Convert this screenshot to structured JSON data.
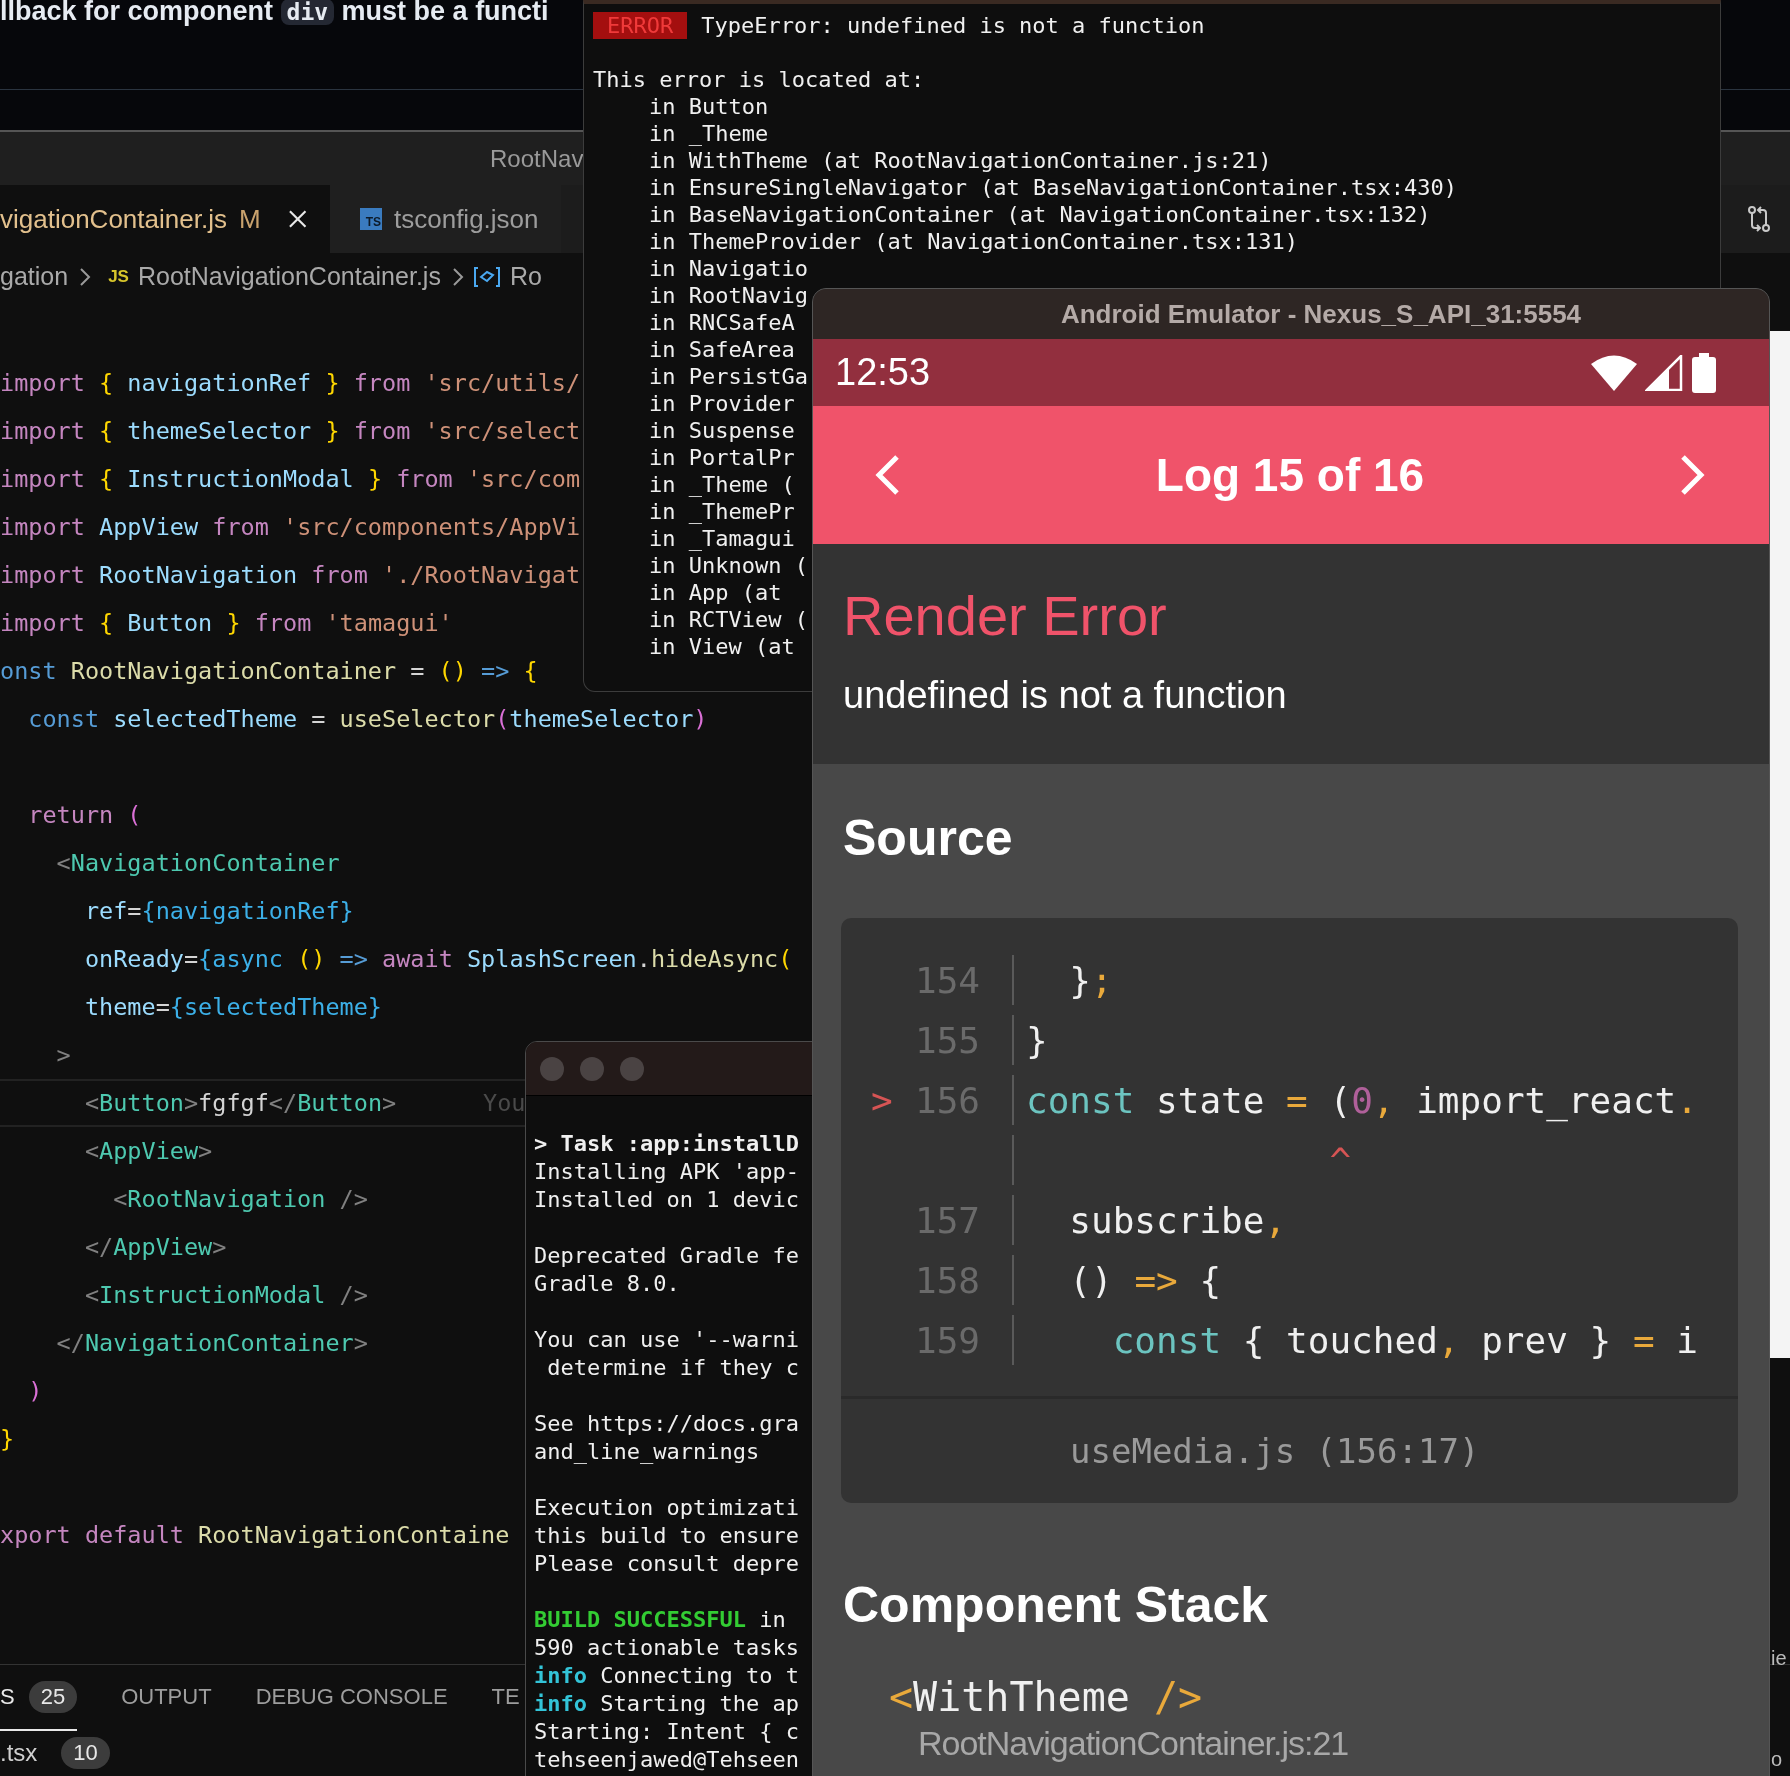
{
  "error_banner": {
    "message_parts": [
      {
        "text": "llback for component ",
        "kind": "plain"
      },
      {
        "text": "div",
        "kind": "code"
      },
      {
        "text": " must be a functi",
        "kind": "plain"
      }
    ]
  },
  "editor": {
    "title": "RootNav",
    "tabs": [
      {
        "label": "vigationContainer.js",
        "status": "M",
        "selected": true,
        "kind": "script"
      },
      {
        "label": "tsconfig.json",
        "selected": false,
        "kind": "config",
        "badge": "TS"
      }
    ],
    "breadcrumb": {
      "folder": "gation",
      "file_badge": "JS",
      "file": "RootNavigationContainer.js",
      "symbol": "Ro"
    },
    "code_lines": [
      {
        "kind": "code",
        "current": false,
        "tokens": [
          {
            "text": "import ",
            "kind": "keyword"
          },
          {
            "text": "{ ",
            "kind": "brace"
          },
          {
            "text": "navigationRef ",
            "kind": "var"
          },
          {
            "text": "} ",
            "kind": "brace"
          },
          {
            "text": "from ",
            "kind": "keyword"
          },
          {
            "text": "'src/utils/",
            "kind": "string"
          }
        ]
      },
      {
        "kind": "code",
        "current": false,
        "tokens": [
          {
            "text": "import ",
            "kind": "keyword"
          },
          {
            "text": "{ ",
            "kind": "brace"
          },
          {
            "text": "themeSelector ",
            "kind": "var"
          },
          {
            "text": "} ",
            "kind": "brace"
          },
          {
            "text": "from ",
            "kind": "keyword"
          },
          {
            "text": "'src/select",
            "kind": "string"
          }
        ]
      },
      {
        "kind": "code",
        "current": false,
        "tokens": [
          {
            "text": "import ",
            "kind": "keyword"
          },
          {
            "text": "{ ",
            "kind": "brace"
          },
          {
            "text": "InstructionModal ",
            "kind": "var"
          },
          {
            "text": "} ",
            "kind": "brace"
          },
          {
            "text": "from ",
            "kind": "keyword"
          },
          {
            "text": "'src/com",
            "kind": "string"
          }
        ]
      },
      {
        "kind": "code",
        "current": false,
        "tokens": [
          {
            "text": "import ",
            "kind": "keyword"
          },
          {
            "text": "AppView ",
            "kind": "var"
          },
          {
            "text": "from ",
            "kind": "keyword"
          },
          {
            "text": "'src/components/AppVi",
            "kind": "string"
          }
        ]
      },
      {
        "kind": "code",
        "current": false,
        "tokens": [
          {
            "text": "import ",
            "kind": "keyword"
          },
          {
            "text": "RootNavigation ",
            "kind": "var"
          },
          {
            "text": "from ",
            "kind": "keyword"
          },
          {
            "text": "'./RootNavigat",
            "kind": "string"
          }
        ]
      },
      {
        "kind": "code",
        "current": false,
        "tokens": [
          {
            "text": "import ",
            "kind": "keyword"
          },
          {
            "text": "{ ",
            "kind": "brace"
          },
          {
            "text": "Button ",
            "kind": "var"
          },
          {
            "text": "} ",
            "kind": "brace"
          },
          {
            "text": "from ",
            "kind": "keyword"
          },
          {
            "text": "'tamagui'",
            "kind": "string"
          }
        ]
      },
      {
        "kind": "code",
        "current": false,
        "tokens": [
          {
            "text": "onst ",
            "kind": "decl"
          },
          {
            "text": "RootNavigationContainer ",
            "kind": "function"
          },
          {
            "text": "= ",
            "kind": "plain"
          },
          {
            "text": "() ",
            "kind": "brace"
          },
          {
            "text": "=> ",
            "kind": "decl"
          },
          {
            "text": "{",
            "kind": "brace"
          }
        ]
      },
      {
        "kind": "code",
        "current": false,
        "tokens": [
          {
            "text": "  const ",
            "kind": "decl"
          },
          {
            "text": "selectedTheme ",
            "kind": "var"
          },
          {
            "text": "= ",
            "kind": "plain"
          },
          {
            "text": "useSelector",
            "kind": "function"
          },
          {
            "text": "(",
            "kind": "paren"
          },
          {
            "text": "themeSelector",
            "kind": "var"
          },
          {
            "text": ")",
            "kind": "paren"
          }
        ]
      },
      {
        "kind": "blank",
        "current": false
      },
      {
        "kind": "code",
        "current": false,
        "tokens": [
          {
            "text": "  return ",
            "kind": "keyword"
          },
          {
            "text": "(",
            "kind": "paren"
          }
        ]
      },
      {
        "kind": "code",
        "current": false,
        "tokens": [
          {
            "text": "    <",
            "kind": "punct"
          },
          {
            "text": "NavigationContainer",
            "kind": "tag"
          }
        ]
      },
      {
        "kind": "code",
        "current": false,
        "tokens": [
          {
            "text": "      ref",
            "kind": "var"
          },
          {
            "text": "=",
            "kind": "plain"
          },
          {
            "text": "{navigationRef}",
            "kind": "jsx"
          }
        ]
      },
      {
        "kind": "code",
        "current": false,
        "tokens": [
          {
            "text": "      onReady",
            "kind": "var"
          },
          {
            "text": "=",
            "kind": "plain"
          },
          {
            "text": "{async ",
            "kind": "jsx"
          },
          {
            "text": "() ",
            "kind": "brace"
          },
          {
            "text": "=> ",
            "kind": "decl"
          },
          {
            "text": "await ",
            "kind": "keyword"
          },
          {
            "text": "SplashScreen",
            "kind": "var"
          },
          {
            "text": ".",
            "kind": "plain"
          },
          {
            "text": "hideAsync",
            "kind": "function"
          },
          {
            "text": "(",
            "kind": "brace"
          }
        ]
      },
      {
        "kind": "code",
        "current": false,
        "tokens": [
          {
            "text": "      theme",
            "kind": "var"
          },
          {
            "text": "=",
            "kind": "plain"
          },
          {
            "text": "{selectedTheme}",
            "kind": "jsx"
          }
        ]
      },
      {
        "kind": "code",
        "current": false,
        "tokens": [
          {
            "text": "    >",
            "kind": "punct"
          }
        ]
      },
      {
        "kind": "code",
        "current": true,
        "blame": "You",
        "tokens": [
          {
            "text": "      <",
            "kind": "punct"
          },
          {
            "text": "Button",
            "kind": "tag"
          },
          {
            "text": ">",
            "kind": "punct"
          },
          {
            "text": "fgfgf",
            "kind": "plain"
          },
          {
            "text": "</",
            "kind": "punct"
          },
          {
            "text": "Button",
            "kind": "tag"
          },
          {
            "text": ">",
            "kind": "punct"
          }
        ]
      },
      {
        "kind": "code",
        "current": false,
        "tokens": [
          {
            "text": "      <",
            "kind": "punct"
          },
          {
            "text": "AppView",
            "kind": "tag"
          },
          {
            "text": ">",
            "kind": "punct"
          }
        ]
      },
      {
        "kind": "code",
        "current": false,
        "tokens": [
          {
            "text": "        <",
            "kind": "punct"
          },
          {
            "text": "RootNavigation",
            "kind": "tag"
          },
          {
            "text": " />",
            "kind": "punct"
          }
        ]
      },
      {
        "kind": "code",
        "current": false,
        "tokens": [
          {
            "text": "      </",
            "kind": "punct"
          },
          {
            "text": "AppView",
            "kind": "tag"
          },
          {
            "text": ">",
            "kind": "punct"
          }
        ]
      },
      {
        "kind": "code",
        "current": false,
        "tokens": [
          {
            "text": "      <",
            "kind": "punct"
          },
          {
            "text": "InstructionModal",
            "kind": "tag"
          },
          {
            "text": " />",
            "kind": "punct"
          }
        ]
      },
      {
        "kind": "code",
        "current": false,
        "tokens": [
          {
            "text": "    </",
            "kind": "punct"
          },
          {
            "text": "NavigationContainer",
            "kind": "tag"
          },
          {
            "text": ">",
            "kind": "punct"
          }
        ]
      },
      {
        "kind": "code",
        "current": false,
        "tokens": [
          {
            "text": "  )",
            "kind": "paren"
          }
        ]
      },
      {
        "kind": "code",
        "current": false,
        "tokens": [
          {
            "text": "}",
            "kind": "brace"
          }
        ]
      },
      {
        "kind": "blank",
        "current": false
      },
      {
        "kind": "code",
        "current": false,
        "tokens": [
          {
            "text": "xport ",
            "kind": "keyword"
          },
          {
            "text": "default ",
            "kind": "keyword"
          },
          {
            "text": "RootNavigationContaine",
            "kind": "function"
          }
        ]
      }
    ]
  },
  "panel": {
    "tabs": [
      {
        "label": "S",
        "count": "25",
        "selected": true
      },
      {
        "label": "OUTPUT",
        "selected": false
      },
      {
        "label": "DEBUG CONSOLE",
        "selected": false
      },
      {
        "label": "TE",
        "selected": false
      }
    ],
    "problem_files": [
      {
        "label": ".tsx",
        "count": "10"
      }
    ]
  },
  "right_edge": {
    "texts": [
      "ie",
      "o"
    ]
  },
  "metro_terminal": {
    "badge": "ERROR",
    "message": "TypeError: undefined is not a function",
    "lines": [
      {
        "kind": "header",
        "text": "This error is located at:"
      },
      {
        "kind": "frame",
        "text": "in Button"
      },
      {
        "kind": "frame",
        "text": "in _Theme"
      },
      {
        "kind": "frame",
        "text": "in WithTheme (at RootNavigationContainer.js:21)"
      },
      {
        "kind": "frame",
        "text": "in EnsureSingleNavigator (at BaseNavigationContainer.tsx:430)"
      },
      {
        "kind": "frame",
        "text": "in BaseNavigationContainer (at NavigationContainer.tsx:132)"
      },
      {
        "kind": "frame",
        "text": "in ThemeProvider (at NavigationContainer.tsx:131)"
      },
      {
        "kind": "frame",
        "text": "in Navigatio"
      },
      {
        "kind": "frame",
        "text": "in RootNavig"
      },
      {
        "kind": "frame",
        "text": "in RNCSafeA"
      },
      {
        "kind": "frame",
        "text": "in SafeArea"
      },
      {
        "kind": "frame",
        "text": "in PersistGa"
      },
      {
        "kind": "frame",
        "text": "in Provider"
      },
      {
        "kind": "frame",
        "text": "in Suspense"
      },
      {
        "kind": "frame",
        "text": "in PortalPr"
      },
      {
        "kind": "frame",
        "text": "in _Theme ("
      },
      {
        "kind": "frame",
        "text": "in _ThemePr"
      },
      {
        "kind": "frame",
        "text": "in _Tamagui"
      },
      {
        "kind": "frame",
        "text": "in Unknown ("
      },
      {
        "kind": "frame",
        "text": "in App (at"
      },
      {
        "kind": "frame",
        "text": "in RCTView ("
      },
      {
        "kind": "frame",
        "text": "in View (at"
      }
    ]
  },
  "build_terminal": {
    "lines": [
      {
        "kind": "text",
        "tokens": [
          {
            "text": "> Task :app:installD",
            "kind": "bold"
          }
        ]
      },
      {
        "kind": "text",
        "tokens": [
          {
            "text": "Installing APK 'app-",
            "kind": "plain"
          }
        ]
      },
      {
        "kind": "text",
        "tokens": [
          {
            "text": "Installed on 1 devic",
            "kind": "plain"
          }
        ]
      },
      {
        "kind": "blank"
      },
      {
        "kind": "text",
        "tokens": [
          {
            "text": "Deprecated Gradle fe",
            "kind": "plain"
          }
        ]
      },
      {
        "kind": "text",
        "tokens": [
          {
            "text": "Gradle 8.0.",
            "kind": "plain"
          }
        ]
      },
      {
        "kind": "blank"
      },
      {
        "kind": "text",
        "tokens": [
          {
            "text": "You can use '--warni",
            "kind": "plain"
          }
        ]
      },
      {
        "kind": "text",
        "tokens": [
          {
            "text": " determine if they c",
            "kind": "plain"
          }
        ]
      },
      {
        "kind": "blank"
      },
      {
        "kind": "text",
        "tokens": [
          {
            "text": "See https://docs.gra",
            "kind": "plain"
          }
        ]
      },
      {
        "kind": "text",
        "tokens": [
          {
            "text": "and_line_warnings",
            "kind": "plain"
          }
        ]
      },
      {
        "kind": "blank"
      },
      {
        "kind": "text",
        "tokens": [
          {
            "text": "Execution optimizati",
            "kind": "plain"
          }
        ]
      },
      {
        "kind": "text",
        "tokens": [
          {
            "text": "this build to ensure",
            "kind": "plain"
          }
        ]
      },
      {
        "kind": "text",
        "tokens": [
          {
            "text": "Please consult depre",
            "kind": "plain"
          }
        ]
      },
      {
        "kind": "blank"
      },
      {
        "kind": "text",
        "tokens": [
          {
            "text": "BUILD SUCCESSFUL",
            "kind": "success"
          },
          {
            "text": " in",
            "kind": "plain"
          }
        ]
      },
      {
        "kind": "text",
        "tokens": [
          {
            "text": "590 actionable tasks",
            "kind": "plain"
          }
        ]
      },
      {
        "kind": "text",
        "tokens": [
          {
            "text": "info",
            "kind": "info"
          },
          {
            "text": " Connecting to t",
            "kind": "plain"
          }
        ]
      },
      {
        "kind": "text",
        "tokens": [
          {
            "text": "info",
            "kind": "info"
          },
          {
            "text": " Starting the ap",
            "kind": "plain"
          }
        ]
      },
      {
        "kind": "text",
        "tokens": [
          {
            "text": "Starting: Intent { c",
            "kind": "plain"
          }
        ]
      },
      {
        "kind": "text",
        "tokens": [
          {
            "text": "tehseenjawed@Tehseen",
            "kind": "plain"
          }
        ]
      }
    ]
  },
  "emulator": {
    "title": "Android Emulator - Nexus_S_API_31:5554",
    "time": "12:53",
    "header_title": "Log 15 of 16",
    "error_title": "Render Error",
    "error_message": "undefined is not a function",
    "source_heading": "Source",
    "source_lines": [
      {
        "kind": "code",
        "number": "154",
        "tokens": [
          {
            "text": "  }",
            "kind": "plain"
          },
          {
            "text": ";",
            "kind": "punct"
          }
        ]
      },
      {
        "kind": "code",
        "number": "155",
        "tokens": [
          {
            "text": "}",
            "kind": "plain"
          }
        ]
      },
      {
        "kind": "code",
        "number": "156",
        "marker": ">",
        "tokens": [
          {
            "text": "const ",
            "kind": "keyword"
          },
          {
            "text": "state ",
            "kind": "plain"
          },
          {
            "text": "= ",
            "kind": "punct"
          },
          {
            "text": "(",
            "kind": "plain"
          },
          {
            "text": "0",
            "kind": "number"
          },
          {
            "text": ", ",
            "kind": "punct"
          },
          {
            "text": "import_react",
            "kind": "plain"
          },
          {
            "text": ".",
            "kind": "punct"
          }
        ]
      },
      {
        "kind": "caret",
        "text": "              ^"
      },
      {
        "kind": "code",
        "number": "157",
        "tokens": [
          {
            "text": "  subscribe",
            "kind": "plain"
          },
          {
            "text": ",",
            "kind": "punct"
          }
        ]
      },
      {
        "kind": "code",
        "number": "158",
        "tokens": [
          {
            "text": "  () ",
            "kind": "plain"
          },
          {
            "text": "=> ",
            "kind": "punct"
          },
          {
            "text": "{",
            "kind": "plain"
          }
        ]
      },
      {
        "kind": "code",
        "number": "159",
        "tokens": [
          {
            "text": "    const ",
            "kind": "keyword"
          },
          {
            "text": "{ touched",
            "kind": "plain"
          },
          {
            "text": ", ",
            "kind": "punct"
          },
          {
            "text": "prev } ",
            "kind": "plain"
          },
          {
            "text": "= ",
            "kind": "punct"
          },
          {
            "text": "i",
            "kind": "plain"
          }
        ]
      }
    ],
    "source_location": "useMedia.js (156:17)",
    "stack_heading": "Component Stack",
    "stack": [
      {
        "tokens": [
          {
            "text": "<",
            "kind": "punct"
          },
          {
            "text": "WithTheme ",
            "kind": "plain"
          },
          {
            "text": "/>",
            "kind": "punct"
          }
        ],
        "location": "RootNavigationContainer.js:21"
      }
    ]
  }
}
